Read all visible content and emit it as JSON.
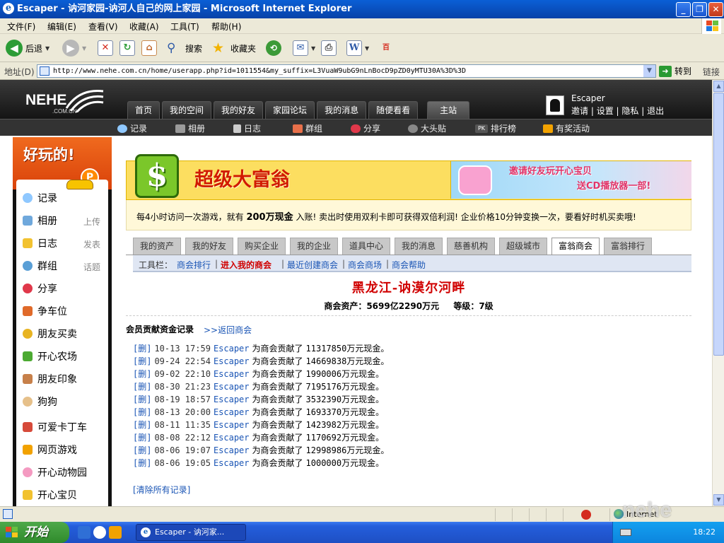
{
  "window": {
    "title": "Escaper - 讷河家园-讷河人自己的网上家园 - Microsoft Internet Explorer",
    "minimize": "_",
    "maximize": "❐",
    "close": "✕"
  },
  "menubar": [
    "文件(F)",
    "编辑(E)",
    "查看(V)",
    "收藏(A)",
    "工具(T)",
    "帮助(H)"
  ],
  "toolbar": {
    "back": "后退",
    "search": "搜索",
    "favorites": "收藏夹"
  },
  "address": {
    "label": "地址(D)",
    "url": "http://www.nehe.com.cn/home/userapp.php?id=1011554&my_suffix=L3VuaW9ubG9nLnBocD9pZD0yMTU30A%3D%3D",
    "go": "转到",
    "links": "链接"
  },
  "site": {
    "logo": "NEHE",
    "logo_sub": ".COM.CN",
    "nav": [
      "首页",
      "我的空间",
      "我的好友",
      "家园论坛",
      "我的消息",
      "随便看看",
      "主站"
    ],
    "nav_active": "主站",
    "user": {
      "name": "Escaper",
      "links": [
        "邀请",
        "设置",
        "隐私",
        "退出"
      ]
    },
    "subnav": [
      "记录",
      "相册",
      "日志",
      "群组",
      "分享",
      "大头贴",
      "排行榜",
      "有奖活动"
    ]
  },
  "sidebar": {
    "header": "好玩的!",
    "badge": "P",
    "items": [
      {
        "label": "记录",
        "extra": ""
      },
      {
        "label": "相册",
        "extra": "上传"
      },
      {
        "label": "日志",
        "extra": "发表"
      },
      {
        "label": "群组",
        "extra": "话题"
      },
      {
        "label": "分享",
        "extra": ""
      },
      {
        "label": "争车位",
        "extra": ""
      },
      {
        "label": "朋友买卖",
        "extra": ""
      },
      {
        "label": "开心农场",
        "extra": ""
      },
      {
        "label": "朋友印象",
        "extra": ""
      },
      {
        "label": "狗狗",
        "extra": ""
      },
      {
        "label": "可爱卡丁车",
        "extra": ""
      },
      {
        "label": "网页游戏",
        "extra": ""
      },
      {
        "label": "开心动物园",
        "extra": ""
      },
      {
        "label": "开心宝贝",
        "extra": ""
      }
    ]
  },
  "game": {
    "title": "超级大富翁",
    "promo_line1": "邀请好友玩开心宝贝",
    "promo_line2": "送CD播放器一部!",
    "intro_pre": "每4小时访问一次游戏，就有",
    "intro_cash": "200万现金",
    "intro_post": "入账! 卖出时使用双利卡即可获得双倍利润! 企业价格10分钟变换一次，要看好时机买卖哦!",
    "tabs": [
      "我的资产",
      "我的好友",
      "购买企业",
      "我的企业",
      "道具中心",
      "我的消息",
      "慈善机构",
      "超级城市",
      "富翁商会",
      "富翁排行"
    ],
    "active_tab": "富翁商会",
    "toolbar_label": "工具栏：",
    "toolbar_links": [
      "商会排行",
      "进入我的商会",
      "最近创建商会",
      "商会商场",
      "商会帮助"
    ],
    "toolbar_active": "进入我的商会",
    "guild": {
      "name": "黑龙江-讷漠尔河畔",
      "assets": "商会资产：5699亿2290万元",
      "level": "等级：7级"
    },
    "records_title": "会员贡献资金记录",
    "back_link": ">>返回商会",
    "records": [
      {
        "del": "[删]",
        "time": "10-13 17:59",
        "user": "Escaper",
        "action": "为商会贡献了",
        "amount": "11317850",
        "unit": "万元现金。"
      },
      {
        "del": "[删]",
        "time": "09-24 22:54",
        "user": "Escaper",
        "action": "为商会贡献了",
        "amount": "14669838",
        "unit": "万元现金。"
      },
      {
        "del": "[删]",
        "time": "09-02 22:10",
        "user": "Escaper",
        "action": "为商会贡献了",
        "amount": "1990006",
        "unit": "万元现金。"
      },
      {
        "del": "[删]",
        "time": "08-30 21:23",
        "user": "Escaper",
        "action": "为商会贡献了",
        "amount": "7195176",
        "unit": "万元现金。"
      },
      {
        "del": "[删]",
        "time": "08-19 18:57",
        "user": "Escaper",
        "action": "为商会贡献了",
        "amount": "3532390",
        "unit": "万元现金。"
      },
      {
        "del": "[删]",
        "time": "08-13 20:00",
        "user": "Escaper",
        "action": "为商会贡献了",
        "amount": "1693370",
        "unit": "万元现金。"
      },
      {
        "del": "[删]",
        "time": "08-11 11:35",
        "user": "Escaper",
        "action": "为商会贡献了",
        "amount": "1423982",
        "unit": "万元现金。"
      },
      {
        "del": "[删]",
        "time": "08-08 22:12",
        "user": "Escaper",
        "action": "为商会贡献了",
        "amount": "1170692",
        "unit": "万元现金。"
      },
      {
        "del": "[删]",
        "time": "08-06 19:07",
        "user": "Escaper",
        "action": "为商会贡献了",
        "amount": "12998986",
        "unit": "万元现金。"
      },
      {
        "del": "[删]",
        "time": "08-06 19:05",
        "user": "Escaper",
        "action": "为商会贡献了",
        "amount": "1000000",
        "unit": "万元现金。"
      }
    ],
    "clear_all": "[清除所有记录]"
  },
  "statusbar": {
    "zone": "Internet"
  },
  "taskbar": {
    "start": "开始",
    "task": "Escaper - 讷河家...",
    "clock": "18:22"
  },
  "watermark": "nehe",
  "colors": {
    "title_blue": "#0a5fd6",
    "site_dark": "#1a1a1a",
    "link_blue": "#1a55b5",
    "accent_red": "#d00000",
    "banner_yellow": "#fcde60",
    "sidebar_orange": "#e8521a",
    "taskbar_blue": "#245edb",
    "start_green": "#3c9a38"
  }
}
